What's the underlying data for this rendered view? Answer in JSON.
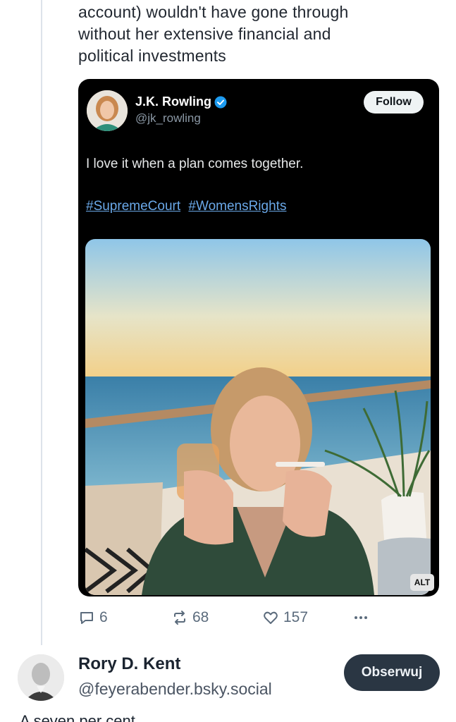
{
  "post": {
    "lines": [
      "account) wouldn't have gone through",
      "without her extensive financial and",
      "political investments"
    ]
  },
  "embed": {
    "author_name": "J.K. Rowling",
    "author_handle": "@jk_rowling",
    "follow_label": "Follow",
    "text": "I love it when a plan comes together.",
    "hashtags": [
      "#SupremeCourt",
      "#WomensRights"
    ],
    "alt_badge": "ALT",
    "image_icon": "photo-woman-on-yacht-deck"
  },
  "actions": {
    "replies": "6",
    "reposts": "68",
    "likes": "157",
    "reply_icon": "comment-icon",
    "repost_icon": "repost-icon",
    "like_icon": "heart-icon",
    "more_icon": "more-dots-icon"
  },
  "reply": {
    "name": "Rory D. Kent",
    "handle": "@feyerabender.bsky.social",
    "follow_label": "Obserwuj",
    "cut_text": "A seven per cent ... ... ... ... ... ..."
  },
  "colors": {
    "follow_button_dark": "#2a3643",
    "link_blue": "#6aa8e8",
    "verified_blue": "#1d9bf0",
    "embed_background": "#000000"
  }
}
